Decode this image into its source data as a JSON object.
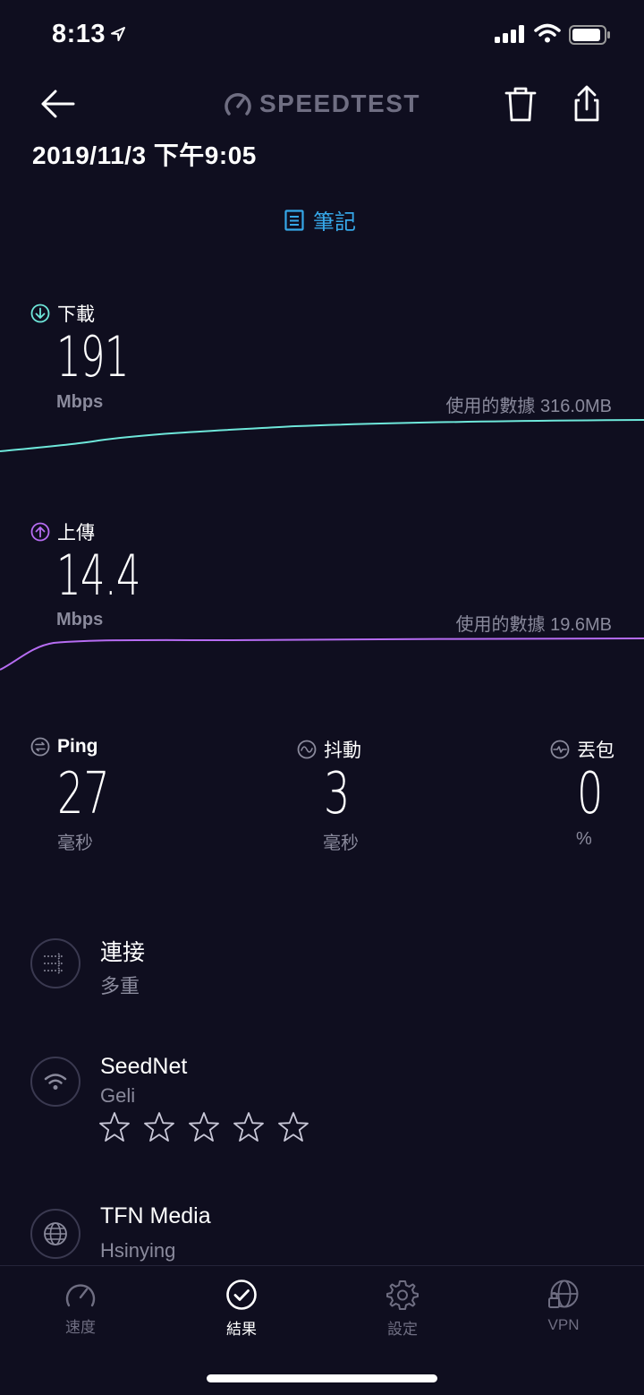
{
  "status_bar": {
    "time": "8:13"
  },
  "header": {
    "brand": "SPEEDTEST"
  },
  "result": {
    "datetime": "2019/11/3 下午9:05",
    "notes_label": "筆記"
  },
  "download": {
    "label": "下載",
    "value": "191",
    "unit": "Mbps",
    "data_used": "使用的數據 316.0MB",
    "color": "#6ee7da"
  },
  "upload": {
    "label": "上傳",
    "value": "14.4",
    "unit": "Mbps",
    "data_used": "使用的數據 19.6MB",
    "color": "#b66cf2"
  },
  "ping": {
    "label": "Ping",
    "value": "27",
    "unit": "毫秒"
  },
  "jitter": {
    "label": "抖動",
    "value": "3",
    "unit": "毫秒"
  },
  "packet_loss": {
    "label": "丟包",
    "value": "0",
    "unit": "%"
  },
  "connection": {
    "title": "連接",
    "value": "多重"
  },
  "provider": {
    "name": "SeedNet",
    "location": "Geli",
    "rating": 0,
    "rating_max": 5
  },
  "server": {
    "name": "TFN Media",
    "location": "Hsinying"
  },
  "nav": {
    "speed": "速度",
    "results": "結果",
    "settings": "設定",
    "vpn": "VPN"
  },
  "colors": {
    "accent": "#36a7e8",
    "background": "#0f0e1f",
    "muted": "#8a8a9c"
  }
}
